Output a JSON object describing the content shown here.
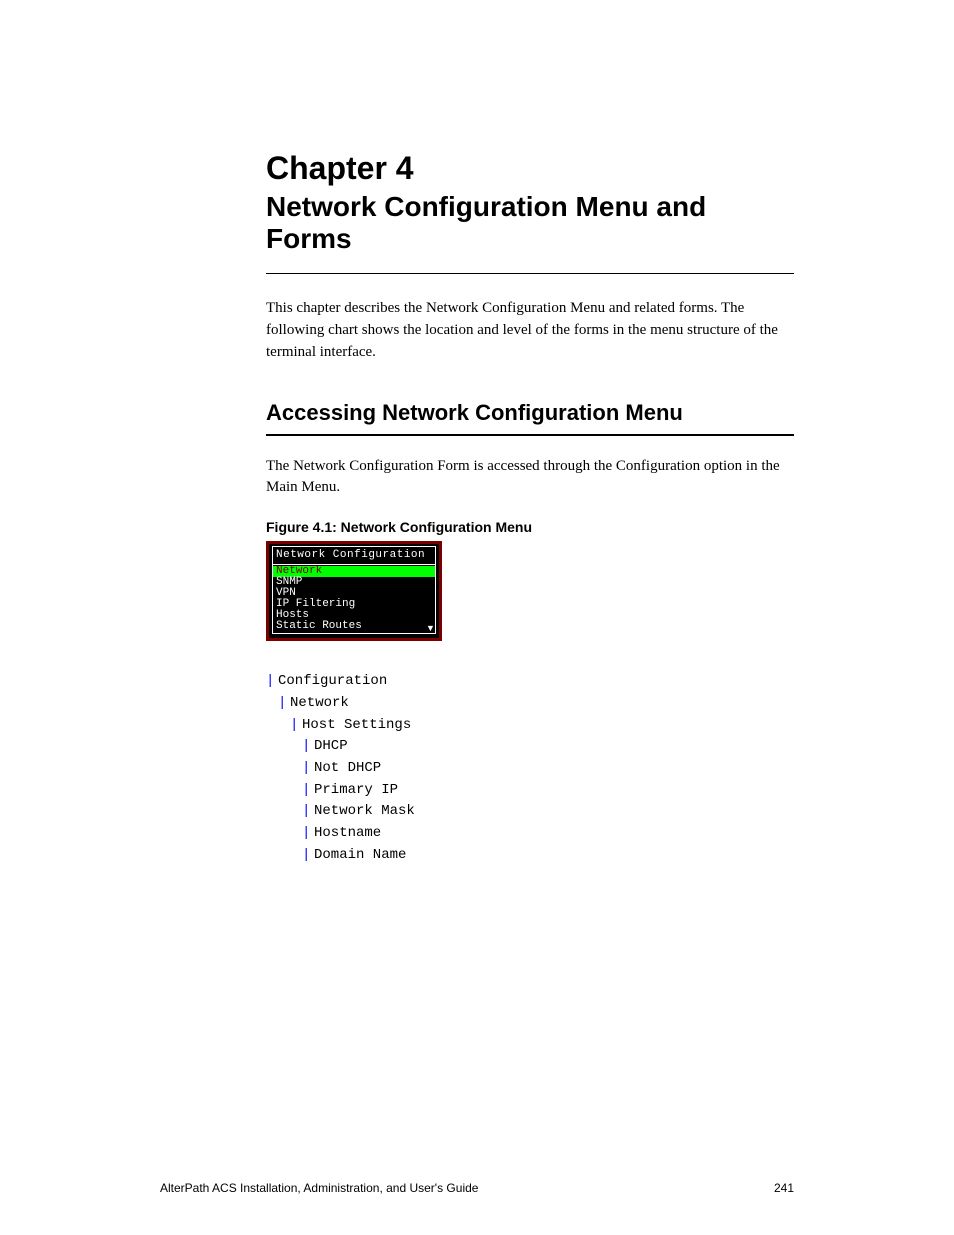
{
  "chapter": {
    "number": "Chapter 4",
    "title": "Network Configuration Menu and Forms"
  },
  "intro": "This chapter describes the Network Configuration Menu and related forms. The following chart shows the location and level of the forms in the menu structure of the terminal interface.",
  "section": {
    "heading": "Accessing Network Configuration Menu",
    "para": "The Network Configuration Form is accessed through the Configuration option in the Main Menu.",
    "figure_label": "Figure 4.1: Network Configuration Menu"
  },
  "tui": {
    "title": "Network Configuration",
    "items": [
      "Network",
      "SNMP",
      "VPN",
      "IP Filtering",
      "Hosts",
      "Static Routes"
    ],
    "selected_index": 0
  },
  "tree": [
    {
      "indent": 0,
      "label": "Configuration"
    },
    {
      "indent": 1,
      "label": "Network"
    },
    {
      "indent": 2,
      "label": "Host Settings"
    },
    {
      "indent": 3,
      "label": "DHCP"
    },
    {
      "indent": 3,
      "label": "Not DHCP"
    },
    {
      "indent": 3,
      "label": "Primary IP"
    },
    {
      "indent": 3,
      "label": "Network Mask"
    },
    {
      "indent": 3,
      "label": "Hostname"
    },
    {
      "indent": 3,
      "label": "Domain Name"
    }
  ],
  "footer": {
    "book": "AlterPath ACS Installation, Administration, and User's Guide",
    "page": "241"
  }
}
